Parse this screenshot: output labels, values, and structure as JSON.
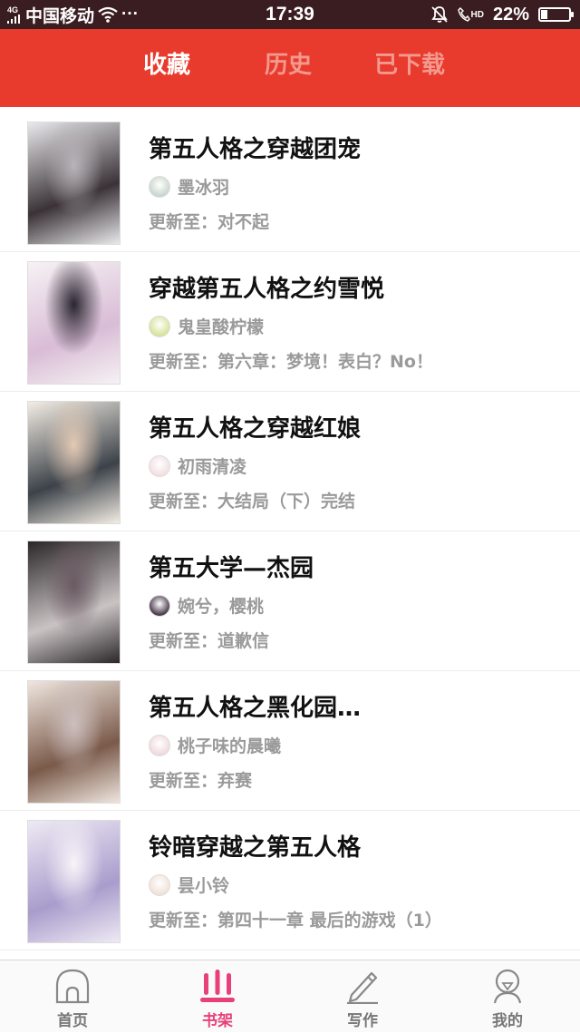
{
  "status_bar": {
    "network_type": "4G",
    "carrier": "中国移动",
    "more": "···",
    "time": "17:39",
    "hd": "HD",
    "battery_text": "22%",
    "battery_level": 0.22
  },
  "header": {
    "tabs": [
      {
        "label": "收藏",
        "active": true
      },
      {
        "label": "历史",
        "active": false
      },
      {
        "label": "已下载",
        "active": false
      }
    ]
  },
  "books": [
    {
      "title": "第五人格之穿越团宠",
      "author": "墨冰羽",
      "update": "更新至：对不起",
      "cover_colors": [
        "#e9e9ec",
        "#3a3236",
        "#b8b3b8"
      ],
      "avatar_color": "#c9d6cc"
    },
    {
      "title": "穿越第五人格之约雪悦",
      "author": "鬼皇酸柠檬",
      "update": "更新至：第六章：梦境！表白？No！",
      "cover_colors": [
        "#f6f2f4",
        "#d9bcd6",
        "#2a2530"
      ],
      "avatar_color": "#d7e39a"
    },
    {
      "title": "第五人格之穿越红娘",
      "author": "初雨清凌",
      "update": "更新至：大结局（下）完结",
      "cover_colors": [
        "#f3ede4",
        "#3c4249",
        "#e2c9b4"
      ],
      "avatar_color": "#f3dfe2"
    },
    {
      "title": "第五大学—杰园",
      "author": "婉兮，樱桃",
      "update": "更新至：道歉信",
      "cover_colors": [
        "#2b2628",
        "#c9c3c4",
        "#6a5a62"
      ],
      "avatar_color": "#4a3a4c"
    },
    {
      "title": "第五人格之黑化园…",
      "author": "桃子味的晨曦",
      "update": "更新至：弃赛",
      "cover_colors": [
        "#efe6df",
        "#7a5a4a",
        "#cdbfbf"
      ],
      "avatar_color": "#f0d9de"
    },
    {
      "title": "铃暗穿越之第五人格",
      "author": "昙小铃",
      "update": "更新至：第四十一章  最后的游戏（1）",
      "cover_colors": [
        "#eeeaf4",
        "#a99ccc",
        "#f7f4f9"
      ],
      "avatar_color": "#f1e2d8"
    }
  ],
  "bottom_nav": [
    {
      "label": "首页",
      "icon": "home-icon",
      "active": false
    },
    {
      "label": "书架",
      "icon": "bookshelf-icon",
      "active": true
    },
    {
      "label": "写作",
      "icon": "pencil-icon",
      "active": false
    },
    {
      "label": "我的",
      "icon": "profile-icon",
      "active": false
    }
  ],
  "colors": {
    "header": "#e83a2d",
    "active_nav": "#e8407a",
    "status_bar": "#3a1d20"
  }
}
